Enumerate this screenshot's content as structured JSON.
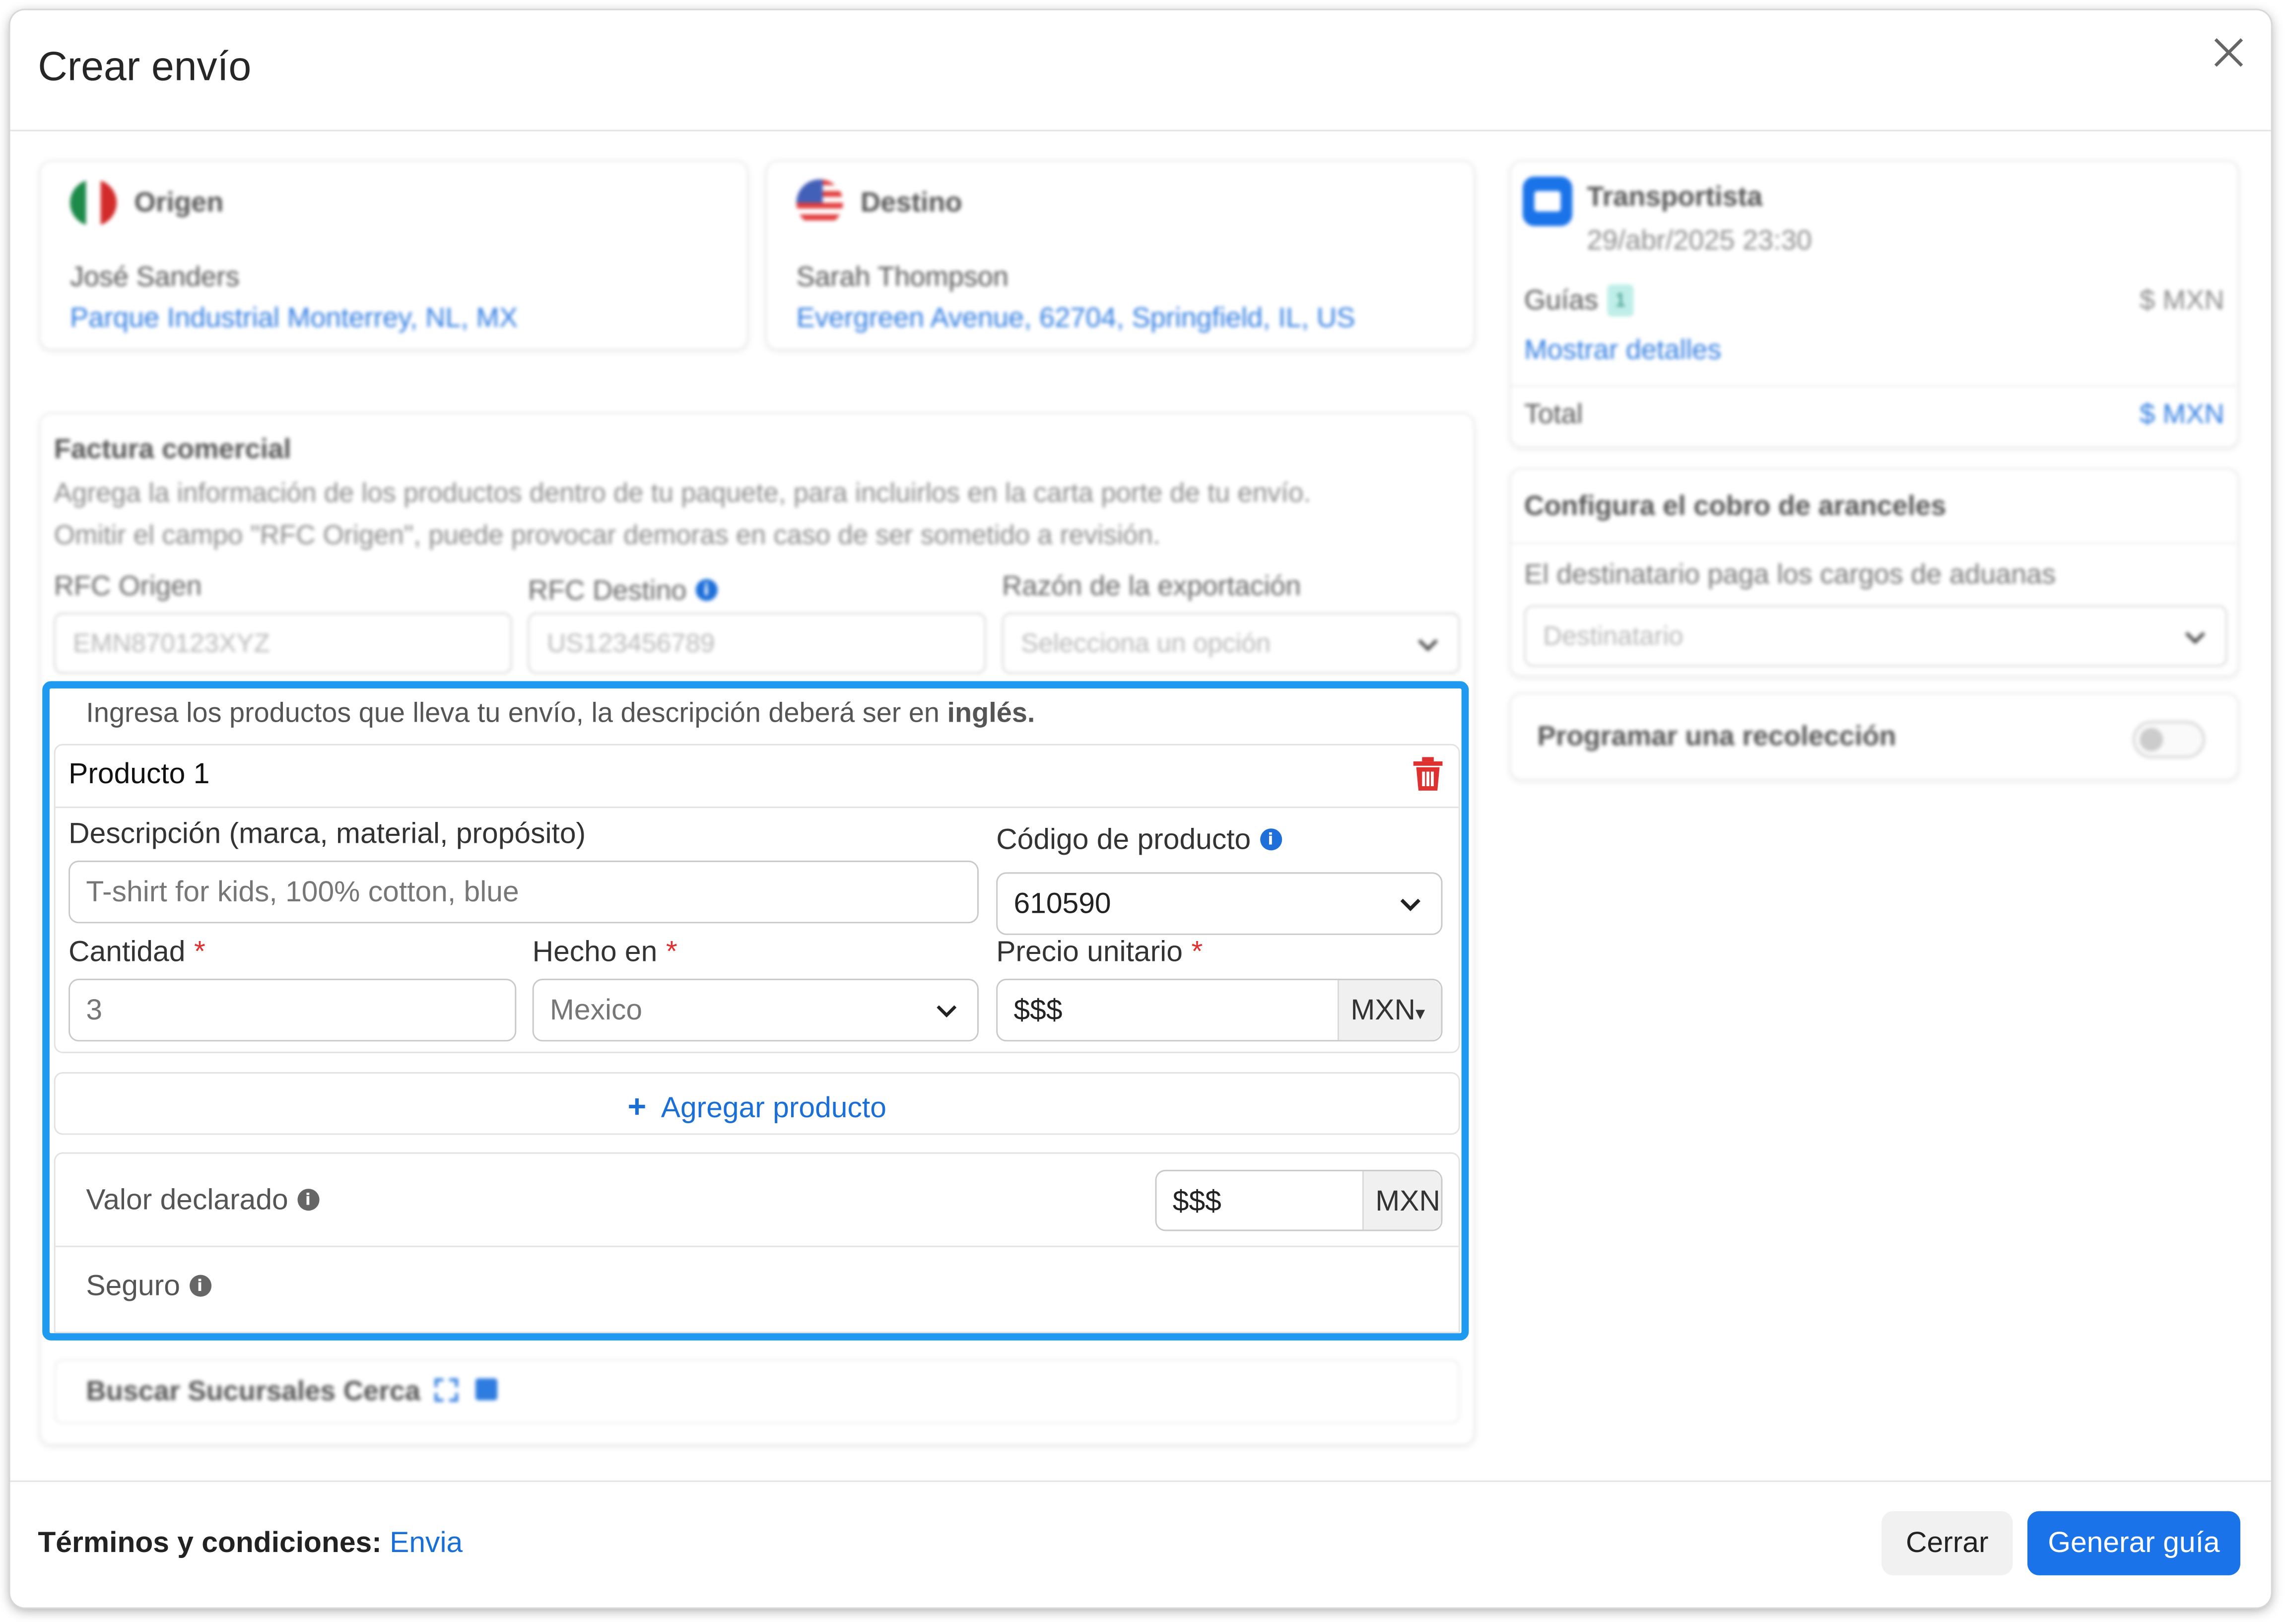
{
  "modal": {
    "title": "Crear envío"
  },
  "origin": {
    "heading": "Origen",
    "name": "José Sanders",
    "address": "Parque Industrial Monterrey, NL, MX"
  },
  "destination": {
    "heading": "Destino",
    "name": "Sarah Thompson",
    "address": "Evergreen Avenue, 62704, Springfield, IL, US"
  },
  "carrier": {
    "heading": "Transportista",
    "datetime": "29/abr/2025 23:30",
    "guides_label": "Guías",
    "guides_count": "1",
    "guides_price": "$ MXN",
    "details_link": "Mostrar detalles",
    "total_label": "Total",
    "total_value": "$ MXN"
  },
  "duties": {
    "heading": "Configura el cobro de aranceles",
    "label": "El destinatario paga los cargos de aduanas",
    "value": "Destinatario"
  },
  "pickup": {
    "label": "Programar una recolección"
  },
  "invoice": {
    "heading": "Factura comercial",
    "desc_line1": "Agrega la información de los productos dentro de tu paquete, para incluirlos en la carta porte de tu envío.",
    "desc_line2": "Omitir el campo \"RFC Origen\", puede provocar demoras en caso de ser sometido a revisión.",
    "rfc_origin_label": "RFC Origen",
    "rfc_origin_value": "EMN870123XYZ",
    "rfc_dest_label": "RFC Destino",
    "rfc_dest_value": "US123456789",
    "reason_label": "Razón de la exportación",
    "reason_placeholder": "Selecciona un opción"
  },
  "products": {
    "instruction_prefix": "Ingresa los productos que lleva tu envío, la descripción deberá ser en ",
    "instruction_bold": "inglés.",
    "product_title": "Producto 1",
    "description_label": "Descripción (marca, material, propósito)",
    "description_placeholder": "T-shirt for kids, 100% cotton, blue",
    "code_label": "Código de producto",
    "code_value": "610590",
    "quantity_label": "Cantidad",
    "quantity_value": "3",
    "made_in_label": "Hecho en",
    "made_in_value": "Mexico",
    "unit_price_label": "Precio unitario",
    "unit_price_value": "$$$",
    "unit_currency": "MXN",
    "add_product": "Agregar producto",
    "required_mark": "*",
    "declared_label": "Valor declarado",
    "declared_value": "$$$",
    "declared_currency": "MXN",
    "insurance_label": "Seguro"
  },
  "branches": {
    "label": "Buscar Sucursales Cerca"
  },
  "footer": {
    "terms_label": "Términos y condiciones:",
    "terms_link": "Envia",
    "close_button": "Cerrar",
    "generate_button": "Generar guía"
  },
  "colors": {
    "accent": "#1a73e8",
    "highlight_border": "#1e9bf0",
    "danger": "#e03131"
  }
}
